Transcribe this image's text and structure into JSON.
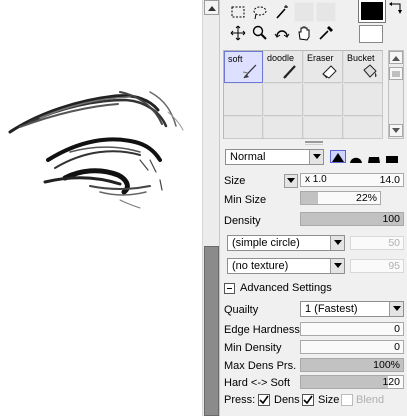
{
  "brush_tabs": [
    {
      "name": "soft",
      "selected": true
    },
    {
      "name": "doodle",
      "selected": false
    },
    {
      "name": "Eraser",
      "selected": false
    },
    {
      "name": "Bucket",
      "selected": false
    }
  ],
  "colors": {
    "foreground": "#000000",
    "background": "#ffffff",
    "accent": "#5a66d2"
  },
  "blend_mode": "Normal",
  "size": {
    "label": "Size",
    "multiplier": "x 1.0",
    "value": "14.0"
  },
  "min_size": {
    "label": "Min Size",
    "value": "22%",
    "fraction": 0.22
  },
  "density": {
    "label": "Density",
    "value": "100",
    "fraction": 1.0
  },
  "brush_shape": {
    "value": "(simple circle)",
    "strength": "50"
  },
  "brush_texture": {
    "value": "(no texture)",
    "strength": "95"
  },
  "advanced": {
    "title": "Advanced Settings",
    "quality": {
      "label": "Quailty",
      "value": "1 (Fastest)"
    },
    "edge_hardness": {
      "label": "Edge Hardness",
      "value": "0",
      "fraction": 0.0
    },
    "min_density": {
      "label": "Min Density",
      "value": "0",
      "fraction": 0.0
    },
    "max_dens_prs": {
      "label": "Max Dens Prs.",
      "value": "100%",
      "fraction": 1.0
    },
    "hard_soft": {
      "label": "Hard <-> Soft",
      "value": "120",
      "fraction": 0.85
    },
    "press": {
      "label": "Press:",
      "dens": "Dens",
      "size": "Size",
      "blend": "Blend",
      "dens_checked": true,
      "size_checked": true,
      "blend_checked": false
    }
  },
  "icons": [
    "rect-select-icon",
    "lasso-icon",
    "magic-wand-icon",
    "move-icon",
    "zoom-icon",
    "rotate-icon",
    "hand-icon",
    "eyedropper-icon",
    "swap-colors-icon"
  ]
}
